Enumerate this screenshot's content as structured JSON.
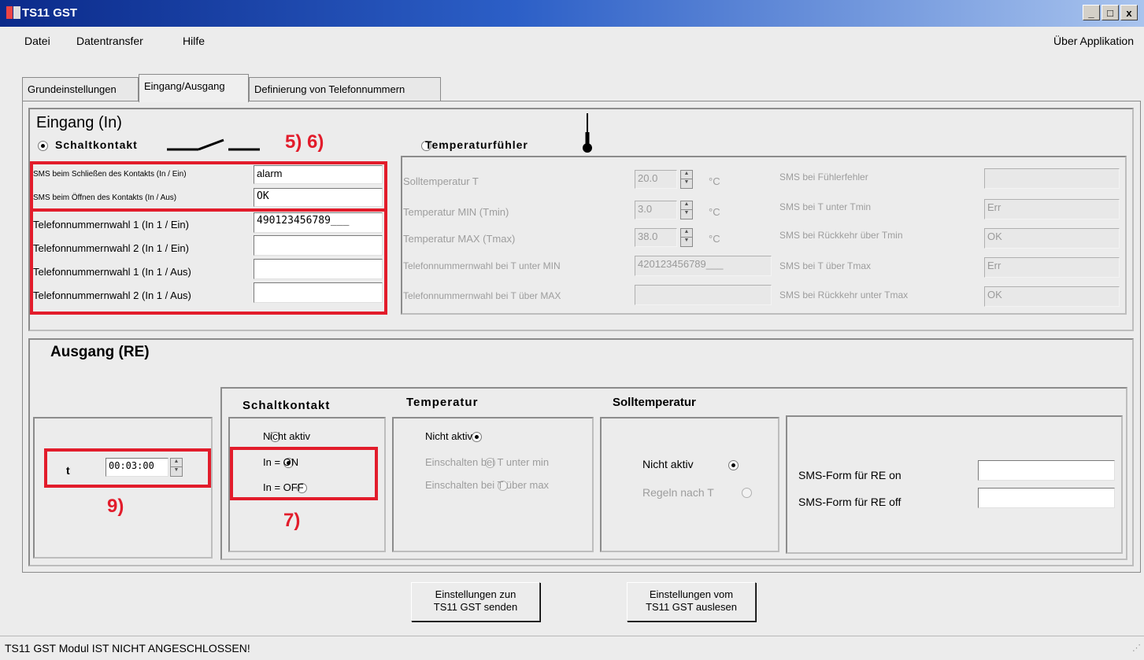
{
  "window": {
    "title": "TS11 GST",
    "minimize": "_",
    "maximize": "□",
    "close": "x"
  },
  "menu": {
    "datei": "Datei",
    "datentransfer": "Datentransfer",
    "hilfe": "Hilfe",
    "ueber": "Über Applikation"
  },
  "tabs": [
    "Grundeinstellungen",
    "Eingang/Ausgang",
    "Definierung von Telefonnummern"
  ],
  "eingang": {
    "heading": "Eingang (In)",
    "schaltkontakt": "Schaltkontakt",
    "temperaturfuehler": "Temperaturfühler",
    "sms_schliessen_label": "SMS beim Schließen des Kontakts (In / Ein)",
    "sms_schliessen_value": "alarm",
    "sms_oeffnen_label": "SMS beim Öffnen des Kontakts (In / Aus)",
    "sms_oeffnen_value": "OK",
    "tel1_ein_label": "Telefonnummernwahl 1 (In 1 / Ein)",
    "tel1_ein_value": "490123456789___",
    "tel2_ein_label": "Telefonnummernwahl 2 (In 1 / Ein)",
    "tel2_ein_value": "",
    "tel1_aus_label": "Telefonnummernwahl 1 (In 1 / Aus)",
    "tel1_aus_value": "",
    "tel2_aus_label": "Telefonnummernwahl 2 (In 1 / Aus)",
    "tel2_aus_value": ""
  },
  "temperatur_panel": {
    "soll_label": "Solltemperatur T",
    "soll_value": "20.0",
    "min_label": "Temperatur MIN (Tmin)",
    "min_value": "3.0",
    "max_label": "Temperatur MAX (Tmax)",
    "max_value": "38.0",
    "unit": "°C",
    "tel_min_label": "Telefonnummernwahl bei T unter MIN",
    "tel_min_value": "420123456789___",
    "tel_max_label": "Telefonnummernwahl bei T über MAX",
    "tel_max_value": "",
    "sms_fuehler_label": "SMS bei Fühlerfehler",
    "sms_fuehler_value": "",
    "sms_unter_label": "SMS bei T unter Tmin",
    "sms_unter_value": "Err",
    "sms_rueck_min_label": "SMS bei Rückkehr über Tmin",
    "sms_rueck_min_value": "OK",
    "sms_ueber_label": "SMS bei T über Tmax",
    "sms_ueber_value": "Err",
    "sms_rueck_max_label": "SMS bei Rückkehr unter Tmax",
    "sms_rueck_max_value": "OK"
  },
  "ausgang": {
    "heading": "Ausgang (RE)",
    "t_label": "t",
    "t_value": "00:03:00",
    "schaltkontakt_title": "Schaltkontakt",
    "sk_options": [
      "Nicht aktiv",
      "In = ON",
      "In = OFF"
    ],
    "temperatur_title": "Temperatur",
    "temp_options": [
      "Nicht aktiv",
      "Einschalten bei T unter min",
      "Einschalten bei T über max"
    ],
    "soll_title": "Solltemperatur",
    "soll_options": [
      "Nicht aktiv",
      "Regeln nach  T"
    ],
    "sms_on_label": "SMS-Form für RE on",
    "sms_on_value": "",
    "sms_off_label": "SMS-Form für RE off",
    "sms_off_value": ""
  },
  "annotations": {
    "a56": "5) 6)",
    "a7": "7)",
    "a9": "9)"
  },
  "buttons": {
    "senden_line1": "Einstellungen zun",
    "senden_line2": "TS11 GST senden",
    "auslesen_line1": "Einstellungen vom",
    "auslesen_line2": "TS11 GST auslesen"
  },
  "status": "TS11 GST Modul IST NICHT ANGESCHLOSSEN!",
  "colors": {
    "annotation_red": "#e21c2b",
    "title_blue": "#0b2a8a"
  }
}
